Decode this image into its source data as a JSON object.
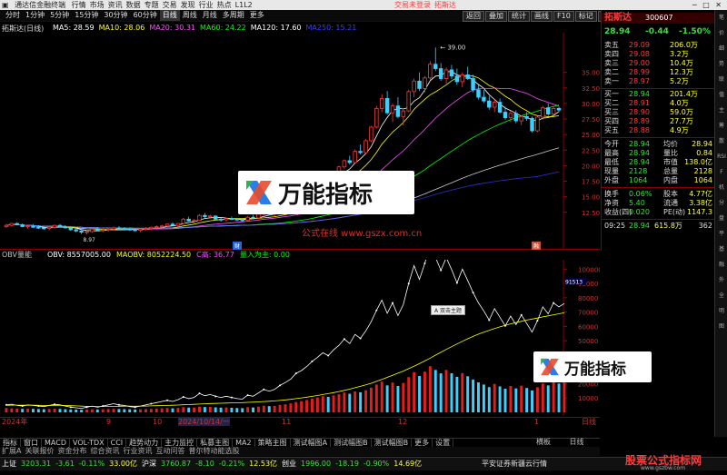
{
  "app": {
    "title": "通达信金融终端",
    "menu": [
      "行情",
      "市场",
      "资讯",
      "数据",
      "专题",
      "交易",
      "发现",
      "行业",
      "热点",
      "L1L2"
    ],
    "notices": [
      "交易未登录",
      "拓斯达"
    ],
    "window_buttons": [
      "─",
      "□",
      "✕"
    ],
    "colors": {
      "up": "#ff3b3b",
      "down": "#3be03b",
      "ma5": "#ffffff",
      "ma10": "#ffff00",
      "ma20": "#ff4bff",
      "ma60": "#00ff00",
      "ma120": "#ffffff",
      "ma250": "#3b3bff"
    }
  },
  "toolbar": {
    "periods": [
      "分时",
      "1分钟",
      "5分钟",
      "15分钟",
      "30分钟",
      "60分钟",
      "日线",
      "周线",
      "月线",
      "多周期",
      "更多"
    ],
    "selected": "日线",
    "right_buttons": [
      "返回",
      "叠加",
      "统计",
      "画线",
      "F10",
      "标记",
      "-",
      "自选",
      "○"
    ]
  },
  "chart": {
    "title": "拓斯达(日线)",
    "ma_legend": [
      {
        "label": "MA5: 28.59",
        "color": "#ffffff"
      },
      {
        "label": "MA10: 28.06",
        "color": "#ffff00"
      },
      {
        "label": "MA20: 30.31",
        "color": "#ff4bff"
      },
      {
        "label": "MA60: 24.22",
        "color": "#00ff00"
      },
      {
        "label": "MA120: 17.60",
        "color": "#ffffff"
      },
      {
        "label": "MA250: 15.21",
        "color": "#3b3bff"
      }
    ],
    "high_label": "39.00",
    "low_label": "8.97",
    "price_ticks": [
      "35.00",
      "32.50",
      "30.00",
      "27.50",
      "25.00",
      "22.50",
      "20.00",
      "17.50",
      "15.00",
      "12.50"
    ],
    "watermark_text": "公式在线 www.gszx.com.cn",
    "tip_badge": "热点互联",
    "marks": [
      "财",
      "融"
    ]
  },
  "chart_data": {
    "type": "candlestick",
    "indicator_title": "OBV量能",
    "obv_legend": [
      {
        "label": "OBV: 8557005.00",
        "color": "#ffffff"
      },
      {
        "label": "MAOBV: 8052224.50",
        "color": "#ffff00"
      },
      {
        "label": "C高: 36.77",
        "color": "#ff4bff"
      },
      {
        "label": "量入为主: 0.00",
        "color": "#00ff00"
      }
    ],
    "obv_ticks": [
      "100000",
      "90000",
      "80000",
      "70000",
      "60000",
      "50000",
      "40000",
      "30000",
      "20000",
      "10000"
    ],
    "obv_top_tag": "91513",
    "x_labels": [
      "2024年",
      "9",
      "10",
      "2024/10/14/一",
      "11",
      "12",
      "1",
      "日线"
    ],
    "candles": [
      [
        10.2,
        10.6,
        10.0,
        10.4
      ],
      [
        10.4,
        10.8,
        10.2,
        10.7
      ],
      [
        10.7,
        10.9,
        10.4,
        10.5
      ],
      [
        10.5,
        10.7,
        10.1,
        10.2
      ],
      [
        10.2,
        10.5,
        9.9,
        10.3
      ],
      [
        10.3,
        10.6,
        10.0,
        10.1
      ],
      [
        10.1,
        10.4,
        9.8,
        10.0
      ],
      [
        10.0,
        10.3,
        9.7,
        9.9
      ],
      [
        9.9,
        10.2,
        9.6,
        10.1
      ],
      [
        10.1,
        10.5,
        9.9,
        10.4
      ],
      [
        10.4,
        10.6,
        10.1,
        10.2
      ],
      [
        10.2,
        10.4,
        9.9,
        10.0
      ],
      [
        10.0,
        10.2,
        9.5,
        9.7
      ],
      [
        9.7,
        10.0,
        9.3,
        9.5
      ],
      [
        9.5,
        9.8,
        9.0,
        9.3
      ],
      [
        9.3,
        9.6,
        8.97,
        9.4
      ],
      [
        9.4,
        9.9,
        9.2,
        9.8
      ],
      [
        9.8,
        10.1,
        9.5,
        9.6
      ],
      [
        9.6,
        9.9,
        9.3,
        9.7
      ],
      [
        9.7,
        10.0,
        9.4,
        9.8
      ],
      [
        9.8,
        10.2,
        9.6,
        10.0
      ],
      [
        10.0,
        10.3,
        9.7,
        9.9
      ],
      [
        9.9,
        10.1,
        9.6,
        9.8
      ],
      [
        9.8,
        10.0,
        9.5,
        9.7
      ],
      [
        9.7,
        9.9,
        9.4,
        9.6
      ],
      [
        9.6,
        9.9,
        9.3,
        9.8
      ],
      [
        9.8,
        10.1,
        9.6,
        9.9
      ],
      [
        9.9,
        10.2,
        9.7,
        10.1
      ],
      [
        10.1,
        10.4,
        9.9,
        10.2
      ],
      [
        10.2,
        10.5,
        10.0,
        10.3
      ],
      [
        10.3,
        10.7,
        10.1,
        10.6
      ],
      [
        10.6,
        10.9,
        10.3,
        10.4
      ],
      [
        10.4,
        10.8,
        10.2,
        10.7
      ],
      [
        10.7,
        11.6,
        10.6,
        11.4
      ],
      [
        11.4,
        11.8,
        11.0,
        11.1
      ],
      [
        11.1,
        11.4,
        10.8,
        11.2
      ],
      [
        11.2,
        12.2,
        11.1,
        12.0
      ],
      [
        12.0,
        12.4,
        11.6,
        11.8
      ],
      [
        11.8,
        12.1,
        11.5,
        11.9
      ],
      [
        11.9,
        12.0,
        11.2,
        11.4
      ],
      [
        11.4,
        11.7,
        11.0,
        11.3
      ],
      [
        11.3,
        11.6,
        11.0,
        11.5
      ],
      [
        11.5,
        11.8,
        11.2,
        11.4
      ],
      [
        11.4,
        11.6,
        11.1,
        11.3
      ],
      [
        11.3,
        11.5,
        11.0,
        11.2
      ],
      [
        11.2,
        11.9,
        11.1,
        11.7
      ],
      [
        11.7,
        12.1,
        11.5,
        11.6
      ],
      [
        11.6,
        12.4,
        11.5,
        12.2
      ],
      [
        12.2,
        12.8,
        12.0,
        12.5
      ],
      [
        12.5,
        12.7,
        12.0,
        12.2
      ],
      [
        12.2,
        12.6,
        11.9,
        12.4
      ],
      [
        12.4,
        13.0,
        12.3,
        12.9
      ],
      [
        12.9,
        13.4,
        12.6,
        13.2
      ],
      [
        13.2,
        13.8,
        13.0,
        13.6
      ],
      [
        13.6,
        14.6,
        13.5,
        14.4
      ],
      [
        14.4,
        15.0,
        14.0,
        14.7
      ],
      [
        14.7,
        15.6,
        14.5,
        15.4
      ],
      [
        15.4,
        16.3,
        15.2,
        16.1
      ],
      [
        16.1,
        17.2,
        15.9,
        17.0
      ],
      [
        17.0,
        18.0,
        16.8,
        17.8
      ],
      [
        17.8,
        18.6,
        17.3,
        17.5
      ],
      [
        17.5,
        18.9,
        17.4,
        18.7
      ],
      [
        18.7,
        20.0,
        18.5,
        19.8
      ],
      [
        19.8,
        21.0,
        19.5,
        20.8
      ],
      [
        20.8,
        21.6,
        20.2,
        20.5
      ],
      [
        20.5,
        22.6,
        20.4,
        22.3
      ],
      [
        22.3,
        23.4,
        21.8,
        22.1
      ],
      [
        22.1,
        24.3,
        21.9,
        24.0
      ],
      [
        24.0,
        26.4,
        23.8,
        26.2
      ],
      [
        26.2,
        29.6,
        26.0,
        29.2
      ],
      [
        29.2,
        31.5,
        28.6,
        30.8
      ],
      [
        30.8,
        32.0,
        28.2,
        28.5
      ],
      [
        28.5,
        30.0,
        27.0,
        29.6
      ],
      [
        29.6,
        31.0,
        27.6,
        27.9
      ],
      [
        27.9,
        29.2,
        26.5,
        28.8
      ],
      [
        28.8,
        32.2,
        28.6,
        31.9
      ],
      [
        31.9,
        34.0,
        31.0,
        33.6
      ],
      [
        33.6,
        35.0,
        32.0,
        32.4
      ],
      [
        32.4,
        34.4,
        31.8,
        34.1
      ],
      [
        34.1,
        36.8,
        33.8,
        36.3
      ],
      [
        36.3,
        39.0,
        35.2,
        35.6
      ],
      [
        35.6,
        36.5,
        33.6,
        34.0
      ],
      [
        34.0,
        35.8,
        33.2,
        35.4
      ],
      [
        35.4,
        36.2,
        33.9,
        34.4
      ],
      [
        34.4,
        35.6,
        33.0,
        33.5
      ],
      [
        33.5,
        35.0,
        32.6,
        34.6
      ],
      [
        34.6,
        35.9,
        33.8,
        34.0
      ],
      [
        34.0,
        34.6,
        31.8,
        32.2
      ],
      [
        32.2,
        33.0,
        30.6,
        31.0
      ],
      [
        31.0,
        32.2,
        30.1,
        30.4
      ],
      [
        30.4,
        31.2,
        29.0,
        29.4
      ],
      [
        29.4,
        30.6,
        28.6,
        30.2
      ],
      [
        30.2,
        30.8,
        28.4,
        28.6
      ],
      [
        28.6,
        29.5,
        27.4,
        27.7
      ],
      [
        27.7,
        28.8,
        27.0,
        28.4
      ],
      [
        28.4,
        28.9,
        26.8,
        27.2
      ],
      [
        27.2,
        28.1,
        26.5,
        27.9
      ],
      [
        27.9,
        28.6,
        27.2,
        27.6
      ],
      [
        27.6,
        27.9,
        25.3,
        25.6
      ],
      [
        25.6,
        28.0,
        25.4,
        27.8
      ],
      [
        27.8,
        29.6,
        27.4,
        29.3
      ],
      [
        29.3,
        30.0,
        28.0,
        28.3
      ],
      [
        28.3,
        29.6,
        28.0,
        29.2
      ],
      [
        29.2,
        29.5,
        28.6,
        28.94
      ]
    ],
    "obv": [
      1300,
      1400,
      1200,
      1100,
      1300,
      1200,
      1100,
      1000,
      1200,
      1400,
      1300,
      1100,
      900,
      800,
      700,
      900,
      1100,
      900,
      1100,
      1300,
      1500,
      1300,
      1200,
      1000,
      900,
      1100,
      1300,
      1500,
      1700,
      1900,
      2100,
      1900,
      2200,
      2700,
      2400,
      2600,
      3300,
      2900,
      3100,
      2800,
      2600,
      2800,
      2600,
      2400,
      2300,
      3000,
      2800,
      3400,
      4000,
      3700,
      4000,
      4700,
      5200,
      5800,
      6800,
      7300,
      8000,
      8900,
      9600,
      10400,
      9900,
      10900,
      11700,
      12800,
      12000,
      13600,
      12900,
      14200,
      15800,
      17800,
      19600,
      17300,
      19100,
      16900,
      18800,
      22500,
      25600,
      23200,
      26000,
      29400,
      27000,
      24800,
      27000,
      24900,
      22600,
      25000,
      23000,
      20900,
      19100,
      17700,
      16100,
      18100,
      16600,
      15100,
      16800,
      15300,
      17000,
      15500,
      14000,
      16000,
      18400,
      17200,
      19100,
      18400,
      19000
    ],
    "maobv": [
      1200,
      1250,
      1250,
      1240,
      1240,
      1230,
      1220,
      1200,
      1190,
      1200,
      1210,
      1190,
      1160,
      1120,
      1080,
      1050,
      1030,
      1010,
      1010,
      1030,
      1050,
      1070,
      1080,
      1080,
      1070,
      1080,
      1100,
      1120,
      1150,
      1180,
      1210,
      1240,
      1270,
      1310,
      1350,
      1390,
      1440,
      1490,
      1530,
      1560,
      1590,
      1620,
      1650,
      1680,
      1700,
      1740,
      1770,
      1820,
      1880,
      1940,
      2000,
      2080,
      2170,
      2270,
      2390,
      2520,
      2650,
      2790,
      2940,
      3100,
      3260,
      3440,
      3630,
      3840,
      4050,
      4290,
      4530,
      4790,
      5080,
      5400,
      5760,
      6110,
      6470,
      6830,
      7200,
      7620,
      8060,
      8500,
      8970,
      9470,
      9980,
      10480,
      10980,
      11470,
      11940,
      12400,
      12840,
      13260,
      13650,
      14000,
      14320,
      14630,
      14920,
      15180,
      15440,
      15670,
      15890,
      16100,
      16280,
      16460,
      16660,
      16840,
      17030,
      17200,
      17380
    ],
    "volume": [
      300,
      280,
      260,
      240,
      250,
      240,
      230,
      220,
      230,
      250,
      240,
      220,
      200,
      190,
      180,
      190,
      210,
      200,
      210,
      230,
      240,
      230,
      220,
      210,
      200,
      210,
      220,
      240,
      260,
      280,
      300,
      280,
      310,
      360,
      330,
      340,
      400,
      370,
      380,
      350,
      330,
      340,
      320,
      300,
      290,
      360,
      340,
      400,
      460,
      430,
      450,
      520,
      560,
      620,
      720,
      780,
      860,
      960,
      1040,
      1120,
      1080,
      1180,
      1260,
      1380,
      1300,
      1460,
      1400,
      1540,
      1720,
      1940,
      2140,
      1880,
      2080,
      1840,
      2050,
      2460,
      2800,
      2540,
      2840,
      3220,
      2960,
      2720,
      2960,
      2730,
      2480,
      2740,
      2520,
      2290,
      2090,
      1940,
      1760,
      1980,
      1810,
      1650,
      1840,
      1670,
      1860,
      1700,
      1530,
      1750,
      2010,
      1880,
      2090,
      2010,
      2080
    ],
    "volume_colors": [
      "red",
      "red",
      "red",
      "cyan",
      "red",
      "cyan",
      "cyan",
      "cyan",
      "red",
      "red",
      "cyan",
      "cyan",
      "cyan",
      "cyan",
      "cyan",
      "red",
      "red",
      "cyan",
      "red",
      "red",
      "red",
      "cyan",
      "cyan",
      "cyan",
      "cyan",
      "red",
      "red",
      "red",
      "red",
      "red",
      "red",
      "cyan",
      "red",
      "red",
      "cyan",
      "red",
      "red",
      "cyan",
      "red",
      "cyan",
      "cyan",
      "red",
      "cyan",
      "cyan",
      "cyan",
      "red",
      "cyan",
      "red",
      "red",
      "cyan",
      "red",
      "red",
      "red",
      "red",
      "red",
      "red",
      "red",
      "red",
      "red",
      "red",
      "cyan",
      "red",
      "red",
      "red",
      "cyan",
      "red",
      "cyan",
      "red",
      "red",
      "red",
      "red",
      "cyan",
      "red",
      "cyan",
      "red",
      "red",
      "red",
      "cyan",
      "red",
      "red",
      "cyan",
      "cyan",
      "red",
      "cyan",
      "cyan",
      "red",
      "cyan",
      "cyan",
      "cyan",
      "cyan",
      "cyan",
      "red",
      "cyan",
      "cyan",
      "red",
      "cyan",
      "red",
      "cyan",
      "cyan",
      "red",
      "red",
      "cyan",
      "red",
      "cyan",
      "red"
    ]
  },
  "quote": {
    "price": "28.94",
    "change": "-0.44",
    "change_pct": "-1.50%",
    "name": "拓斯达",
    "code": "300607",
    "asks": [
      {
        "label": "卖五",
        "price": "29.09",
        "vol": "206.0万"
      },
      {
        "label": "卖四",
        "price": "29.08",
        "vol": "3.2万"
      },
      {
        "label": "卖三",
        "price": "29.00",
        "vol": "10.4万"
      },
      {
        "label": "卖二",
        "price": "28.99",
        "vol": "12.3万"
      },
      {
        "label": "卖一",
        "price": "28.97",
        "vol": "5.2万"
      }
    ],
    "bids": [
      {
        "label": "买一",
        "price": "28.94",
        "vol": "201.4万"
      },
      {
        "label": "买二",
        "price": "28.91",
        "vol": "4.0万"
      },
      {
        "label": "买三",
        "price": "28.90",
        "vol": "59.0万"
      },
      {
        "label": "买四",
        "price": "28.89",
        "vol": "27.7万"
      },
      {
        "label": "买五",
        "price": "28.88",
        "vol": "4.9万"
      }
    ],
    "stats": [
      {
        "k1": "今开",
        "v1": "28.94",
        "k2": "均价",
        "v2": "28.94"
      },
      {
        "k1": "最高",
        "v1": "28.94",
        "k2": "量比",
        "v2": "0.84"
      },
      {
        "k1": "最低",
        "v1": "28.94",
        "k2": "市值",
        "v2": "138.0亿"
      },
      {
        "k1": "现量",
        "v1": "2128",
        "k2": "总量",
        "v2": "2128"
      },
      {
        "k1": "外盘",
        "v1": "1064",
        "k2": "内盘",
        "v2": "1064"
      }
    ],
    "stats2": [
      {
        "k1": "换手",
        "v1": "0.06%",
        "k2": "股本",
        "v2": "4.77亿"
      },
      {
        "k1": "净资",
        "v1": "5.40",
        "k2": "流通",
        "v2": "3.38亿"
      },
      {
        "k1": "收益(四)",
        "v1": "0.020",
        "k2": "PE(动)",
        "v2": "1147.3"
      }
    ],
    "tick": {
      "time": "09:25",
      "price": "28.94",
      "vol": "615.8万",
      "count": "362"
    },
    "clock": "09:25:21",
    "weekday": "周二"
  },
  "right_tabs": [
    "笔",
    "价",
    "细",
    "势",
    "联",
    "值",
    "主",
    "筹",
    "散",
    "RSI",
    "F",
    "机",
    "分",
    "盘",
    "平",
    "基",
    "融",
    "外",
    "全",
    "明",
    "图"
  ],
  "bottom_tabs": [
    "指标",
    "窗口",
    "MACD",
    "VOL-TDX",
    "CCI",
    "趋势动力",
    "主力监控",
    "私募主图",
    "MA2",
    "策略主图",
    "测试幅图A",
    "测试幅图B",
    "测试幅图B",
    "更多",
    "设置"
  ],
  "bottom_tabs2": [
    "扩展A",
    "关联报价",
    "资金分布",
    "综合资讯",
    "行业资讯",
    "互动问答",
    "普尔特动能选股"
  ],
  "bottom_right": [
    "横板",
    "日线"
  ],
  "status": {
    "items": [
      {
        "name": "上证",
        "val": "3203.31",
        "chg": "-3.61",
        "pct": "-0.11%",
        "amt": "33.00亿"
      },
      {
        "name": "沪深",
        "val": "3760.87",
        "chg": "-8.10",
        "pct": "-0.21%",
        "amt": "12.53亿"
      },
      {
        "name": "创业",
        "val": "1996.00",
        "chg": "-18.19",
        "pct": "-0.90%",
        "amt": "14.69亿"
      }
    ],
    "broker": "平安证券新疆云行情",
    "site": "股票公式指标网",
    "site_url": "www.gszbw.com"
  },
  "watermarks": {
    "brand": "万能指标"
  },
  "tooltip": "A 双击主题"
}
